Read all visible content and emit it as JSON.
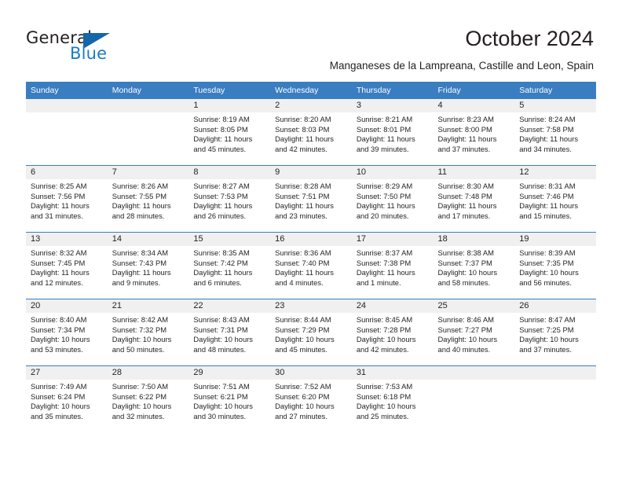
{
  "brand": {
    "name_part1": "General",
    "name_part2": "Blue",
    "accent_color": "#1b7bc4",
    "triangle_color": "#1566ab"
  },
  "header": {
    "title": "October 2024",
    "subtitle": "Manganeses de la Lampreana, Castille and Leon, Spain"
  },
  "calendar": {
    "header_bg": "#3a7dc0",
    "daynum_bg": "#f0f0f0",
    "weekdays": [
      "Sunday",
      "Monday",
      "Tuesday",
      "Wednesday",
      "Thursday",
      "Friday",
      "Saturday"
    ],
    "weeks": [
      [
        {
          "day": "",
          "sunrise": "",
          "sunset": "",
          "daylight1": "",
          "daylight2": ""
        },
        {
          "day": "",
          "sunrise": "",
          "sunset": "",
          "daylight1": "",
          "daylight2": ""
        },
        {
          "day": "1",
          "sunrise": "Sunrise: 8:19 AM",
          "sunset": "Sunset: 8:05 PM",
          "daylight1": "Daylight: 11 hours",
          "daylight2": "and 45 minutes."
        },
        {
          "day": "2",
          "sunrise": "Sunrise: 8:20 AM",
          "sunset": "Sunset: 8:03 PM",
          "daylight1": "Daylight: 11 hours",
          "daylight2": "and 42 minutes."
        },
        {
          "day": "3",
          "sunrise": "Sunrise: 8:21 AM",
          "sunset": "Sunset: 8:01 PM",
          "daylight1": "Daylight: 11 hours",
          "daylight2": "and 39 minutes."
        },
        {
          "day": "4",
          "sunrise": "Sunrise: 8:23 AM",
          "sunset": "Sunset: 8:00 PM",
          "daylight1": "Daylight: 11 hours",
          "daylight2": "and 37 minutes."
        },
        {
          "day": "5",
          "sunrise": "Sunrise: 8:24 AM",
          "sunset": "Sunset: 7:58 PM",
          "daylight1": "Daylight: 11 hours",
          "daylight2": "and 34 minutes."
        }
      ],
      [
        {
          "day": "6",
          "sunrise": "Sunrise: 8:25 AM",
          "sunset": "Sunset: 7:56 PM",
          "daylight1": "Daylight: 11 hours",
          "daylight2": "and 31 minutes."
        },
        {
          "day": "7",
          "sunrise": "Sunrise: 8:26 AM",
          "sunset": "Sunset: 7:55 PM",
          "daylight1": "Daylight: 11 hours",
          "daylight2": "and 28 minutes."
        },
        {
          "day": "8",
          "sunrise": "Sunrise: 8:27 AM",
          "sunset": "Sunset: 7:53 PM",
          "daylight1": "Daylight: 11 hours",
          "daylight2": "and 26 minutes."
        },
        {
          "day": "9",
          "sunrise": "Sunrise: 8:28 AM",
          "sunset": "Sunset: 7:51 PM",
          "daylight1": "Daylight: 11 hours",
          "daylight2": "and 23 minutes."
        },
        {
          "day": "10",
          "sunrise": "Sunrise: 8:29 AM",
          "sunset": "Sunset: 7:50 PM",
          "daylight1": "Daylight: 11 hours",
          "daylight2": "and 20 minutes."
        },
        {
          "day": "11",
          "sunrise": "Sunrise: 8:30 AM",
          "sunset": "Sunset: 7:48 PM",
          "daylight1": "Daylight: 11 hours",
          "daylight2": "and 17 minutes."
        },
        {
          "day": "12",
          "sunrise": "Sunrise: 8:31 AM",
          "sunset": "Sunset: 7:46 PM",
          "daylight1": "Daylight: 11 hours",
          "daylight2": "and 15 minutes."
        }
      ],
      [
        {
          "day": "13",
          "sunrise": "Sunrise: 8:32 AM",
          "sunset": "Sunset: 7:45 PM",
          "daylight1": "Daylight: 11 hours",
          "daylight2": "and 12 minutes."
        },
        {
          "day": "14",
          "sunrise": "Sunrise: 8:34 AM",
          "sunset": "Sunset: 7:43 PM",
          "daylight1": "Daylight: 11 hours",
          "daylight2": "and 9 minutes."
        },
        {
          "day": "15",
          "sunrise": "Sunrise: 8:35 AM",
          "sunset": "Sunset: 7:42 PM",
          "daylight1": "Daylight: 11 hours",
          "daylight2": "and 6 minutes."
        },
        {
          "day": "16",
          "sunrise": "Sunrise: 8:36 AM",
          "sunset": "Sunset: 7:40 PM",
          "daylight1": "Daylight: 11 hours",
          "daylight2": "and 4 minutes."
        },
        {
          "day": "17",
          "sunrise": "Sunrise: 8:37 AM",
          "sunset": "Sunset: 7:38 PM",
          "daylight1": "Daylight: 11 hours",
          "daylight2": "and 1 minute."
        },
        {
          "day": "18",
          "sunrise": "Sunrise: 8:38 AM",
          "sunset": "Sunset: 7:37 PM",
          "daylight1": "Daylight: 10 hours",
          "daylight2": "and 58 minutes."
        },
        {
          "day": "19",
          "sunrise": "Sunrise: 8:39 AM",
          "sunset": "Sunset: 7:35 PM",
          "daylight1": "Daylight: 10 hours",
          "daylight2": "and 56 minutes."
        }
      ],
      [
        {
          "day": "20",
          "sunrise": "Sunrise: 8:40 AM",
          "sunset": "Sunset: 7:34 PM",
          "daylight1": "Daylight: 10 hours",
          "daylight2": "and 53 minutes."
        },
        {
          "day": "21",
          "sunrise": "Sunrise: 8:42 AM",
          "sunset": "Sunset: 7:32 PM",
          "daylight1": "Daylight: 10 hours",
          "daylight2": "and 50 minutes."
        },
        {
          "day": "22",
          "sunrise": "Sunrise: 8:43 AM",
          "sunset": "Sunset: 7:31 PM",
          "daylight1": "Daylight: 10 hours",
          "daylight2": "and 48 minutes."
        },
        {
          "day": "23",
          "sunrise": "Sunrise: 8:44 AM",
          "sunset": "Sunset: 7:29 PM",
          "daylight1": "Daylight: 10 hours",
          "daylight2": "and 45 minutes."
        },
        {
          "day": "24",
          "sunrise": "Sunrise: 8:45 AM",
          "sunset": "Sunset: 7:28 PM",
          "daylight1": "Daylight: 10 hours",
          "daylight2": "and 42 minutes."
        },
        {
          "day": "25",
          "sunrise": "Sunrise: 8:46 AM",
          "sunset": "Sunset: 7:27 PM",
          "daylight1": "Daylight: 10 hours",
          "daylight2": "and 40 minutes."
        },
        {
          "day": "26",
          "sunrise": "Sunrise: 8:47 AM",
          "sunset": "Sunset: 7:25 PM",
          "daylight1": "Daylight: 10 hours",
          "daylight2": "and 37 minutes."
        }
      ],
      [
        {
          "day": "27",
          "sunrise": "Sunrise: 7:49 AM",
          "sunset": "Sunset: 6:24 PM",
          "daylight1": "Daylight: 10 hours",
          "daylight2": "and 35 minutes."
        },
        {
          "day": "28",
          "sunrise": "Sunrise: 7:50 AM",
          "sunset": "Sunset: 6:22 PM",
          "daylight1": "Daylight: 10 hours",
          "daylight2": "and 32 minutes."
        },
        {
          "day": "29",
          "sunrise": "Sunrise: 7:51 AM",
          "sunset": "Sunset: 6:21 PM",
          "daylight1": "Daylight: 10 hours",
          "daylight2": "and 30 minutes."
        },
        {
          "day": "30",
          "sunrise": "Sunrise: 7:52 AM",
          "sunset": "Sunset: 6:20 PM",
          "daylight1": "Daylight: 10 hours",
          "daylight2": "and 27 minutes."
        },
        {
          "day": "31",
          "sunrise": "Sunrise: 7:53 AM",
          "sunset": "Sunset: 6:18 PM",
          "daylight1": "Daylight: 10 hours",
          "daylight2": "and 25 minutes."
        },
        {
          "day": "",
          "sunrise": "",
          "sunset": "",
          "daylight1": "",
          "daylight2": ""
        },
        {
          "day": "",
          "sunrise": "",
          "sunset": "",
          "daylight1": "",
          "daylight2": ""
        }
      ]
    ]
  }
}
